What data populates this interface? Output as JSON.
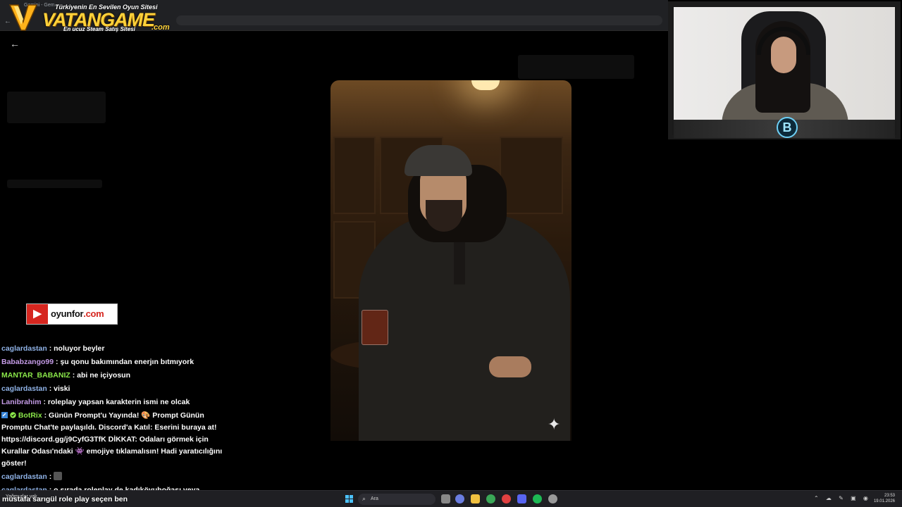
{
  "browser": {
    "tab_title": "Gemini - Gem...",
    "back_label": "←"
  },
  "vatangame": {
    "top_line": "Türkiyenin En Sevilen Oyun Sitesi",
    "brand": "VATANGAME",
    "sub_line": "En ucuz Steam Satış Sitesi",
    "com": ".com"
  },
  "page": {
    "back_arrow": "←"
  },
  "image": {
    "sparkle": "✦"
  },
  "webcam": {
    "logo_letter": "B"
  },
  "oyunfor": {
    "icon": "▶",
    "name_main": "oyunfor",
    "name_suffix": ".com"
  },
  "chat": {
    "messages": [
      {
        "user": "caglardastan",
        "text": ": noluyor beyler"
      },
      {
        "user": "Bababzango99",
        "text": ": şu qonu bakımından enerjın bıtmıyork"
      },
      {
        "user": "MANTAR_BABANIZ",
        "text": ": abi ne içiyosun"
      },
      {
        "user": "caglardastan",
        "text": ": viski"
      },
      {
        "user": "Lanibrahim",
        "text": ": roleplay yapsan karakterin ismi ne olcak"
      },
      {
        "user": "BotRix",
        "text": ": Günün Prompt'u Yayında! 🎨 Prompt Günün Promptu Chat'te paylaşıldı. Discord'a Katıl: Eserini buraya at! https://discord.gg/j9CyfG3TfK DİKKAT: Odaları görmek için Kurallar Odası'ndaki 👾 emojiye tıklamalısın! Hadi yaratıcılığını göster!"
      },
      {
        "user": "caglardastan",
        "text": ":"
      },
      {
        "user": "caglardastan",
        "text": ": o sırada roleplay de kadıköyuboğası veya"
      }
    ],
    "last_line": "mustafa sarıgül role play seçen ben"
  },
  "taskbar": {
    "weather": "Yağmurlar yak...",
    "search_placeholder": "Ara",
    "search_icon": "⌕",
    "time": "23:53",
    "date": "19.01.2026",
    "tray_icons": "⌃ ☁ ✎ ▣ ◉"
  },
  "colors": {
    "accent_gold": "#ffd23a",
    "user_blue": "#8fb2e6",
    "user_purple": "#c49be6",
    "user_green": "#8be84a",
    "oyunfor_red": "#d6261f"
  }
}
